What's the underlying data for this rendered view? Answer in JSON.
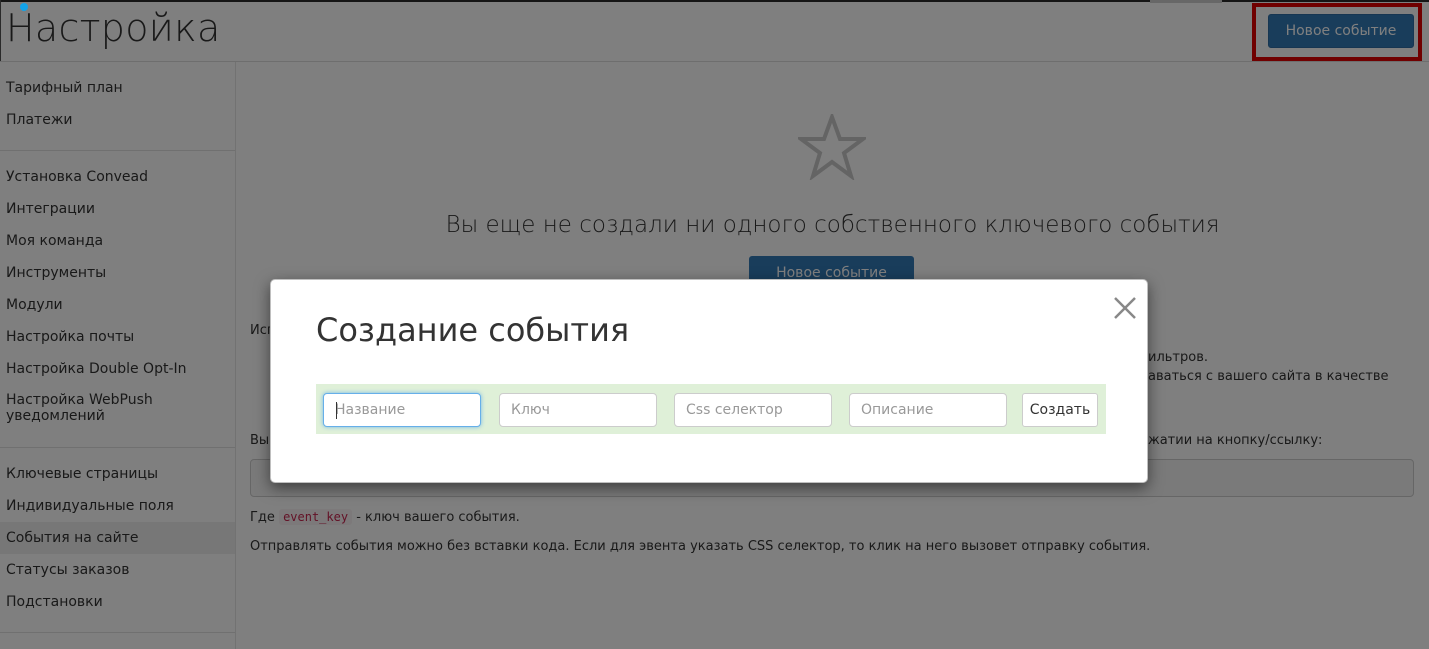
{
  "header": {
    "title": "Настройка",
    "new_event_button": "Новое событие"
  },
  "sidebar": {
    "group1": [
      "Тарифный план",
      "Платежи"
    ],
    "group2": [
      "Установка Convead",
      "Интеграции",
      "Моя команда",
      "Инструменты",
      "Модули",
      "Настройка почты",
      "Настройка Double Opt-In"
    ],
    "webpush_line1": "Настройка WebPush",
    "webpush_line2": "уведомлений",
    "group3": [
      "Ключевые страницы",
      "Индивидуальные поля",
      "События на сайте",
      "Статусы заказов",
      "Подстановки"
    ],
    "active_item": "События на сайте"
  },
  "content": {
    "empty_message": "Вы еще не создали ни одного собственного ключевого события",
    "new_event_button": "Новое событие",
    "partial_left_1": "Исп",
    "partial_right_1": "ильтров.",
    "partial_right_2": "аваться с вашего сайта в качестве",
    "partial_left_2": "Вы",
    "partial_right_3": "жатии на кнопку/ссылку:",
    "where_prefix": "Где",
    "event_key_code": "event_key",
    "where_suffix": "- ключ вашего события.",
    "note": "Отправлять события можно без вставки кода. Если для эвента указать CSS селектор, то клик на него вызовет отправку события."
  },
  "modal": {
    "title": "Создание события",
    "name_placeholder": "Название",
    "key_placeholder": "Ключ",
    "css_placeholder": "Css селектор",
    "description_placeholder": "Описание",
    "create_button": "Создать"
  }
}
